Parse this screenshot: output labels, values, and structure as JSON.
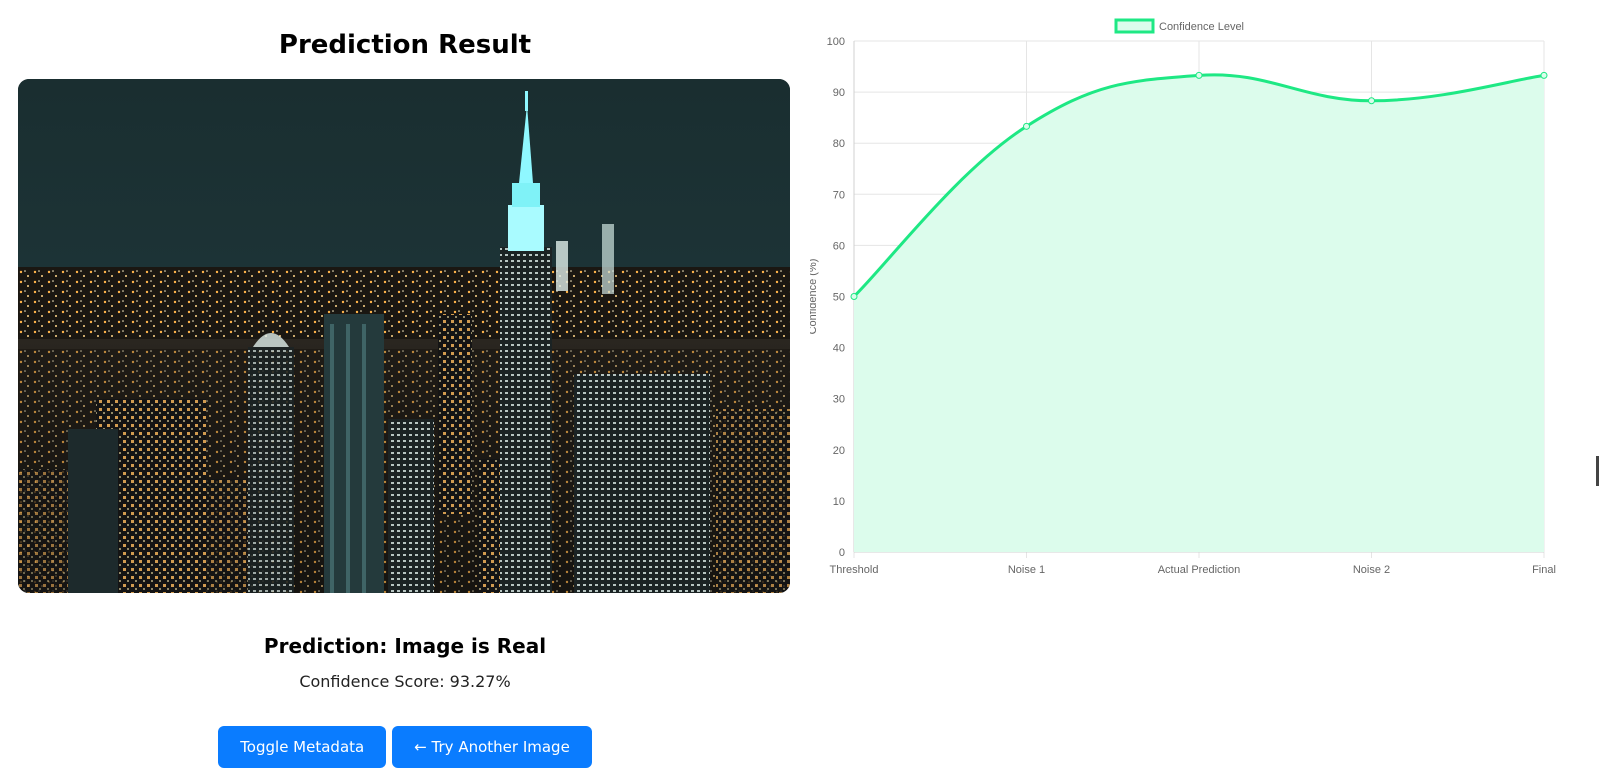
{
  "result": {
    "title": "Prediction Result",
    "prediction": "Prediction: Image is Real",
    "confidence": "Confidence Score: 93.27%"
  },
  "buttons": {
    "toggle_metadata": "Toggle Metadata",
    "try_another": "← Try Another Image"
  },
  "colors": {
    "primary_button": "#0a7cff",
    "line": "#1ee884",
    "fill": "#dcfcec"
  },
  "chart_data": {
    "type": "line",
    "categories": [
      "Threshold",
      "Noise 1",
      "Actual Prediction",
      "Noise 2",
      "Final"
    ],
    "series": [
      {
        "name": "Confidence Level",
        "values": [
          50,
          83.3,
          93.27,
          88.3,
          93.27
        ]
      }
    ],
    "ylabel": "Confidence (%)",
    "ylim": [
      0,
      100
    ],
    "yticks": [
      0,
      10,
      20,
      30,
      40,
      50,
      60,
      70,
      80,
      90,
      100
    ],
    "grid": true,
    "filled": true,
    "legend_position": "top-center"
  }
}
